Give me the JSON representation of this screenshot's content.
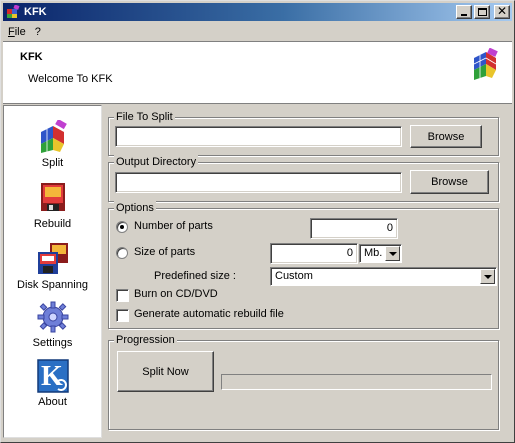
{
  "window": {
    "title": "KFK",
    "controls": {
      "minimize_icon": "minimize-icon",
      "maximize_icon": "maximize-icon",
      "close_label": "✕"
    }
  },
  "menu": [
    {
      "label": "File",
      "underline": "F"
    },
    {
      "label": "?"
    }
  ],
  "header": {
    "title": "KFK",
    "subtitle": "Welcome To KFK",
    "logo_icon": "rubik-cube-icon"
  },
  "sidebar": {
    "items": [
      {
        "label": "Split",
        "icon": "split-cube-icon"
      },
      {
        "label": "Rebuild",
        "icon": "rebuild-icon"
      },
      {
        "label": "Disk Spanning",
        "icon": "disk-spanning-icon"
      },
      {
        "label": "Settings",
        "icon": "settings-gear-icon"
      },
      {
        "label": "About",
        "icon": "about-k-icon"
      }
    ]
  },
  "file_to_split": {
    "group_label": "File To Split",
    "value": "",
    "browse_label": "Browse"
  },
  "output_directory": {
    "group_label": "Output Directory",
    "value": "",
    "browse_label": "Browse"
  },
  "options": {
    "group_label": "Options",
    "number_of_parts": {
      "label": "Number of parts",
      "value": "0",
      "selected": true
    },
    "size_of_parts": {
      "label": "Size of parts",
      "value": "0",
      "unit": "Mb.",
      "selected": false
    },
    "predefined_size": {
      "label": "Predefined size :",
      "value": "Custom"
    },
    "burn_cd": {
      "label": "Burn on CD/DVD",
      "checked": false
    },
    "auto_rebuild": {
      "label": "Generate automatic rebuild file",
      "checked": false
    }
  },
  "progression": {
    "group_label": "Progression",
    "button_label": "Split Now",
    "progress": 0
  },
  "colors": {
    "titlebar_start": "#0a246a",
    "titlebar_end": "#a6caf0",
    "face": "#d4d0c8"
  }
}
